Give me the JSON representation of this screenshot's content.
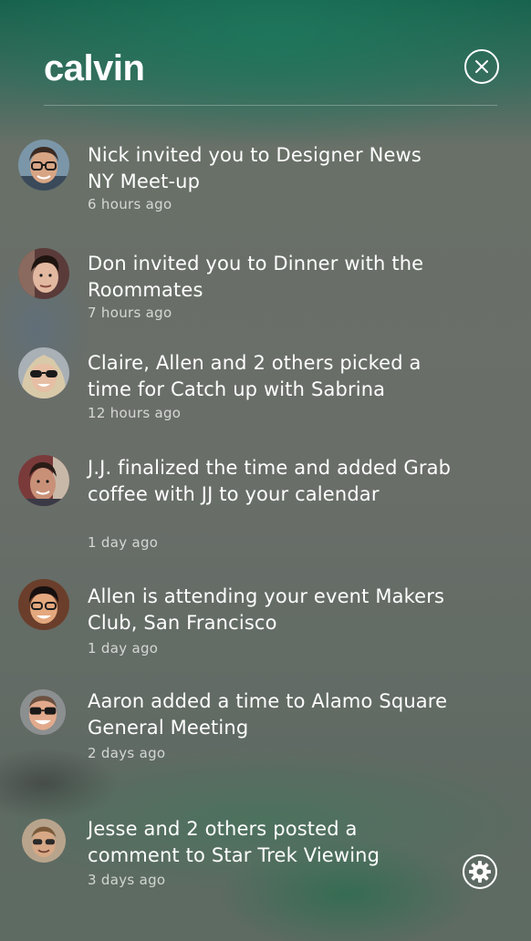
{
  "app": {
    "title": "calvin"
  },
  "header": {
    "close_icon": "close-circle-icon"
  },
  "notifications": [
    {
      "text": "Nick invited you to Designer News NY Meet-up",
      "time": "6 hours ago",
      "avatar": "avatar-nick"
    },
    {
      "text": "Don invited you to Dinner with the Roommates",
      "time": "7 hours ago",
      "avatar": "avatar-don"
    },
    {
      "text": "Claire, Allen and 2 others picked a time for Catch up with Sabrina",
      "time": "12 hours ago",
      "avatar": "avatar-claire"
    },
    {
      "text": "J.J. finalized the time and added Grab coffee with JJ to your calendar",
      "time": "1 day ago",
      "avatar": "avatar-jj"
    },
    {
      "text": "Allen is attending your event Makers Club, San Francisco",
      "time": "1 day ago",
      "avatar": "avatar-allen"
    },
    {
      "text": "Aaron added a time to Alamo Square General Meeting",
      "time": "2 days ago",
      "avatar": "avatar-aaron"
    },
    {
      "text": "Jesse and 2 others posted a comment to Star Trek Viewing",
      "time": "3 days ago",
      "avatar": "avatar-jesse"
    }
  ],
  "footer": {
    "settings_icon": "gear-icon"
  },
  "colors": {
    "header_green": "#17614c",
    "background_gray": "#6a6e69",
    "text": "#ffffff"
  }
}
